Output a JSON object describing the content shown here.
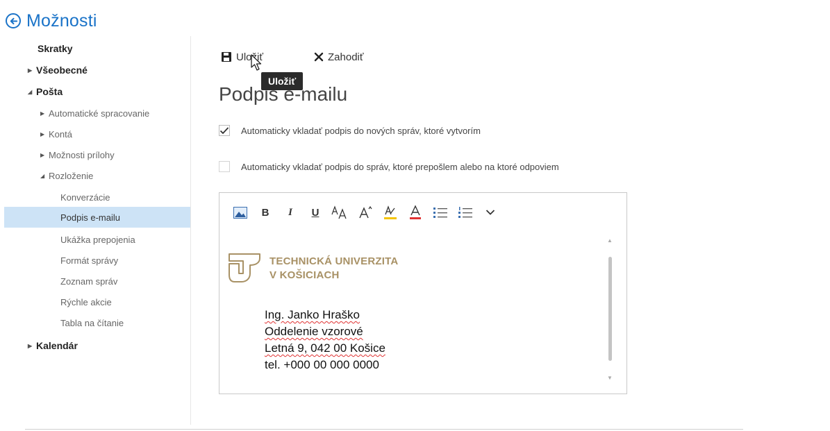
{
  "header": {
    "title": "Možnosti"
  },
  "sidebar": {
    "items": [
      {
        "label": "Skratky",
        "level": 0,
        "arrow": ""
      },
      {
        "label": "Všeobecné",
        "level": 0,
        "arrow": "collapsed"
      },
      {
        "label": "Pošta",
        "level": 0,
        "arrow": "expanded"
      },
      {
        "label": "Automatické spracovanie",
        "level": 1,
        "arrow": "collapsed"
      },
      {
        "label": "Kontá",
        "level": 1,
        "arrow": "collapsed"
      },
      {
        "label": "Možnosti prílohy",
        "level": 1,
        "arrow": "collapsed"
      },
      {
        "label": "Rozloženie",
        "level": 1,
        "arrow": "expanded"
      },
      {
        "label": "Konverzácie",
        "level": 2,
        "arrow": ""
      },
      {
        "label": "Podpis e-mailu",
        "level": 2,
        "arrow": "",
        "selected": true
      },
      {
        "label": "Ukážka prepojenia",
        "level": 2,
        "arrow": ""
      },
      {
        "label": "Formát správy",
        "level": 2,
        "arrow": ""
      },
      {
        "label": "Zoznam správ",
        "level": 2,
        "arrow": ""
      },
      {
        "label": "Rýchle akcie",
        "level": 2,
        "arrow": ""
      },
      {
        "label": "Tabla na čítanie",
        "level": 2,
        "arrow": ""
      },
      {
        "label": "Kalendár",
        "level": 0,
        "arrow": "collapsed"
      }
    ]
  },
  "toolbar": {
    "save_label": "Uložiť",
    "discard_label": "Zahodiť",
    "tooltip": "Uložiť"
  },
  "page": {
    "title": "Podpis e-mailu"
  },
  "options": {
    "auto_new": {
      "label": "Automaticky vkladať podpis do nových správ, ktoré vytvorím",
      "checked": true
    },
    "auto_reply": {
      "label": "Automaticky vkladať podpis do správ, ktoré prepošlem alebo na ktoré odpoviem",
      "checked": false
    }
  },
  "editor": {
    "toolbar_icons": [
      "insert-picture-icon",
      "bold-icon",
      "italic-icon",
      "underline-icon",
      "font-size-icon",
      "grow-font-icon",
      "highlight-icon",
      "font-color-icon",
      "bullets-icon",
      "numbering-icon",
      "more-chevron-icon"
    ],
    "toolbar_glyphs": {
      "bold": "B",
      "italic": "I",
      "underline": "U"
    },
    "logo": {
      "line1": "TECHNICKÁ UNIVERZITA",
      "line2": "V KOŠICIACH"
    },
    "signature": {
      "name": "Ing. Janko Hraško",
      "department": "Oddelenie vzorové",
      "address": "Letná 9, 042 00 Košice",
      "phone": "tel. +000 00 000 0000"
    }
  },
  "colors": {
    "accent": "#1a73c8",
    "selected_bg": "#cde3f6",
    "logo_gold": "#a89165",
    "highlight": "#f5c400",
    "font_color": "#e03131"
  }
}
